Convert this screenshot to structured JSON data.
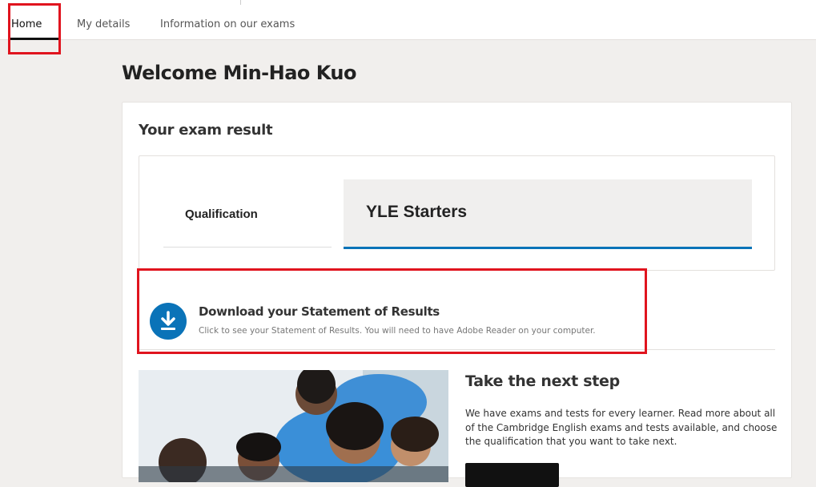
{
  "nav": {
    "items": [
      {
        "label": "Home",
        "active": true
      },
      {
        "label": "My details",
        "active": false
      },
      {
        "label": "Information on our exams",
        "active": false
      }
    ]
  },
  "welcome": "Welcome Min-Hao Kuo",
  "exam_result": {
    "title": "Your exam result",
    "qualification_label": "Qualification",
    "qualification_value": "YLE Starters"
  },
  "download": {
    "icon": "download-icon",
    "title": "Download your Statement of Results",
    "description": "Click to see your Statement of Results. You will need to have Adobe Reader on your computer."
  },
  "next_step": {
    "title": "Take the next step",
    "body": "We have exams and tests for every learner. Read more about all of the Cambridge English exams and tests available, and choose the qualification that you want to take next."
  },
  "colors": {
    "accent": "#0a73b8",
    "highlight_box": "#e0141e"
  }
}
